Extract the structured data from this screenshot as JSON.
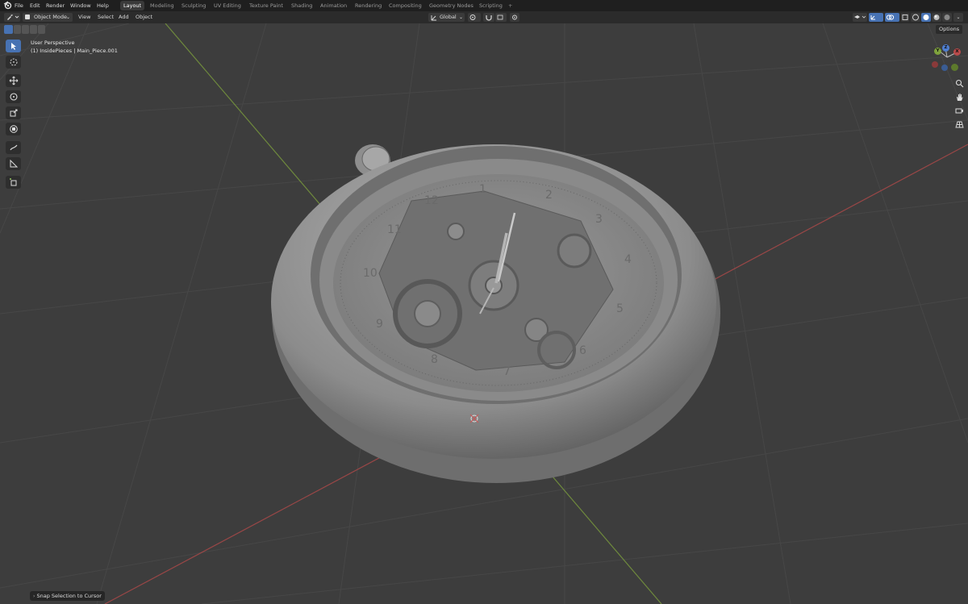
{
  "menubar": {
    "items": [
      "File",
      "Edit",
      "Render",
      "Window",
      "Help"
    ]
  },
  "workspaces": {
    "tabs": [
      "Layout",
      "Modeling",
      "Sculpting",
      "UV Editing",
      "Texture Paint",
      "Shading",
      "Animation",
      "Rendering",
      "Compositing",
      "Geometry Nodes",
      "Scripting"
    ],
    "active": "Layout",
    "add_label": "+"
  },
  "header": {
    "mode": "Object Mode",
    "menus": [
      "View",
      "Select",
      "Add",
      "Object"
    ],
    "orientation": "Global"
  },
  "viewport": {
    "view_name": "User Perspective",
    "object_info": "(1) InsidePieces | Main_Piece.001",
    "options_label": "Options",
    "status_message": "Snap Selection to Cursor",
    "gizmo": {
      "x_label": "X",
      "y_label": "Y",
      "z_label": "Z"
    }
  },
  "watch_dial": {
    "numerals": [
      "1",
      "2",
      "3",
      "4",
      "5",
      "6",
      "7",
      "8",
      "9",
      "10",
      "11",
      "12"
    ]
  },
  "colors": {
    "accent": "#4772b3",
    "x_axis": "#b84a4a",
    "y_axis": "#7fa33d",
    "z_axis": "#4f7fd1",
    "grid_bg": "#3d3d3d"
  }
}
